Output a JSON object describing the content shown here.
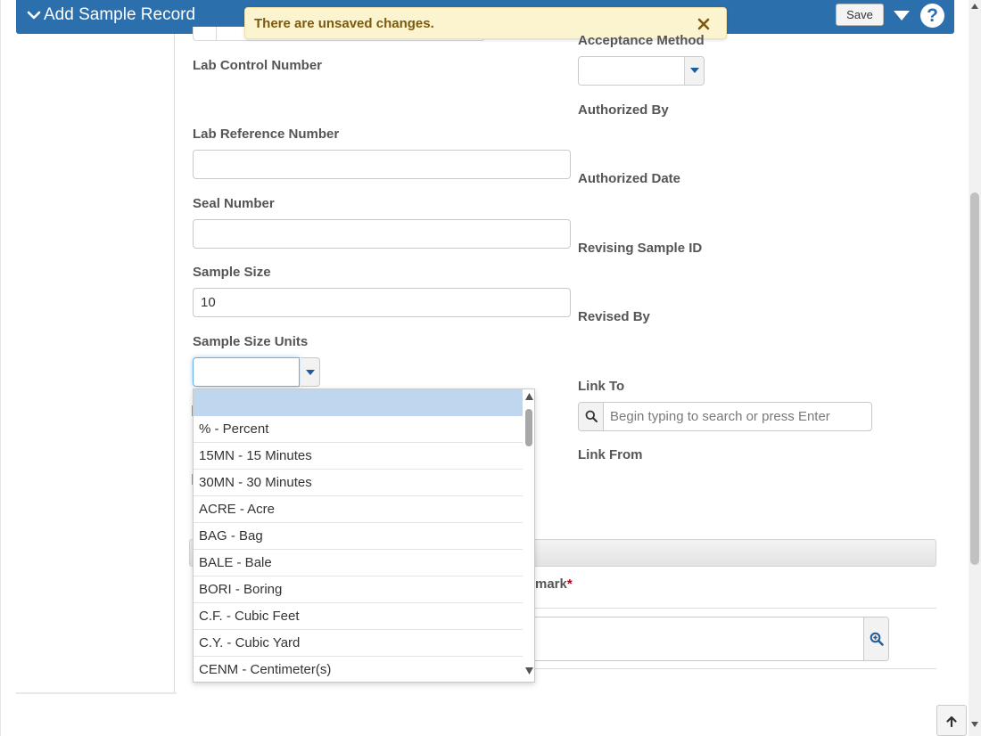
{
  "header": {
    "title": "Add Sample Record",
    "save_label": "Save",
    "accent_color": "#2c6fad"
  },
  "notification": {
    "message": "There are unsaved changes."
  },
  "form_left": {
    "lab_control_number": {
      "label": "Lab Control Number"
    },
    "lab_reference_number": {
      "label": "Lab Reference Number",
      "value": ""
    },
    "seal_number": {
      "label": "Seal Number",
      "value": ""
    },
    "sample_size": {
      "label": "Sample Size",
      "value": "10"
    },
    "sample_size_units": {
      "label": "Sample Size Units",
      "value": ""
    }
  },
  "form_right": {
    "acceptance_method": {
      "label": "Acceptance Method",
      "value": ""
    },
    "authorized_by": {
      "label": "Authorized By"
    },
    "authorized_date": {
      "label": "Authorized Date"
    },
    "revising_sample_id": {
      "label": "Revising Sample ID"
    },
    "revised_by": {
      "label": "Revised By"
    },
    "link_to": {
      "label": "Link To",
      "placeholder": "Begin typing to search or press Enter"
    },
    "link_from": {
      "label": "Link From"
    }
  },
  "remark": {
    "label_visible": "mark",
    "required_marker": "*"
  },
  "units_dropdown": {
    "options": [
      "",
      "% - Percent",
      "15MN - 15 Minutes",
      "30MN - 30 Minutes",
      "ACRE - Acre",
      "BAG - Bag",
      "BALE - Bale",
      "BORI - Boring",
      "C.F. - Cubic Feet",
      "C.Y. - Cubic Yard",
      "CENM - Centimeter(s)"
    ],
    "highlighted_index": 0
  }
}
